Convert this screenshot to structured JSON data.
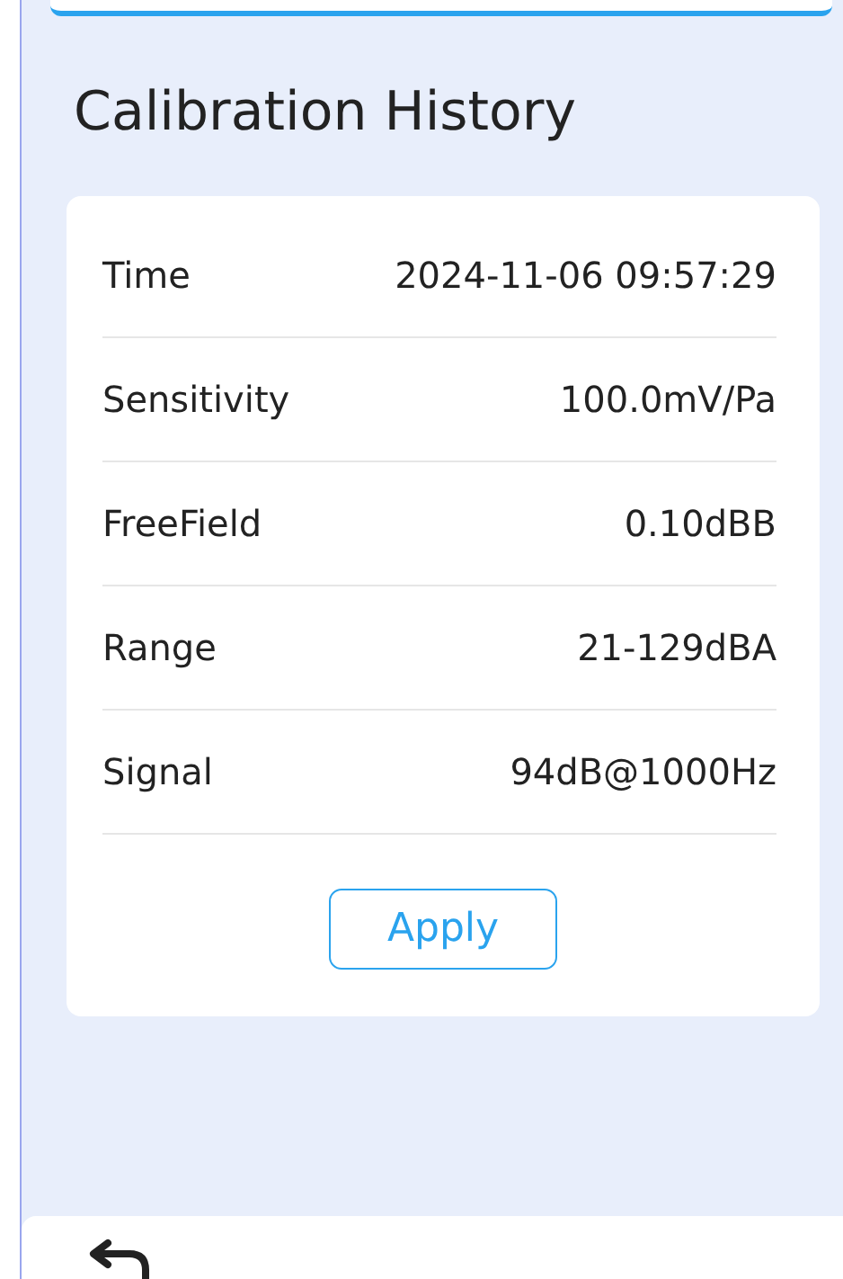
{
  "title": "Calibration History",
  "rows": [
    {
      "label": "Time",
      "value": "2024-11-06 09:57:29"
    },
    {
      "label": "Sensitivity",
      "value": "100.0mV/Pa"
    },
    {
      "label": "FreeField",
      "value": "0.10dBB"
    },
    {
      "label": "Range",
      "value": "21-129dBA"
    },
    {
      "label": "Signal",
      "value": "94dB@1000Hz"
    }
  ],
  "apply_button": "Apply"
}
